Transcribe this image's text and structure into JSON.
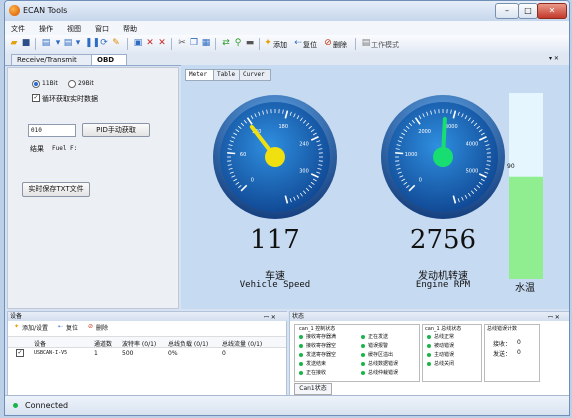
{
  "window": {
    "title": "ECAN Tools",
    "minimize": "–",
    "maximize": "□",
    "close": "✕"
  },
  "menu": [
    "文件",
    "操作",
    "视图",
    "窗口",
    "帮助"
  ],
  "toolbar": {
    "add_label": "添加",
    "reset_label": "复位",
    "delete_label": "删除",
    "workmode_label": "工作模式"
  },
  "tabs": {
    "receive_transmit": "Receive/Transmit",
    "obd": "OBD II",
    "pin": "▾ ✕"
  },
  "left": {
    "radio_11bit": "11Bit",
    "radio_29bit": "29Bit",
    "loop_checkbox": "循环获取实时数据",
    "pid_value": "010",
    "pid_button": "PID手动获取",
    "result_label": "结果",
    "result_value": "Fuel F:",
    "save_button": "实时保存TXT文件"
  },
  "right": {
    "inner_tabs": [
      "Meter",
      "Table",
      "Curver"
    ],
    "speed": {
      "value": "117",
      "label_cn": "车速",
      "label_en": "Vehicle Speed",
      "max": 360,
      "ticks": [
        "0",
        "60",
        "120",
        "180",
        "240",
        "300"
      ],
      "needle_color": "#f0e010"
    },
    "rpm": {
      "value": "2756",
      "label_cn": "发动机转速",
      "label_en": "Engine RPM",
      "max": 6000,
      "ticks": [
        "0",
        "1000",
        "2000",
        "3000",
        "4000",
        "5000"
      ],
      "needle_color": "#18dd70"
    },
    "temp": {
      "label_cn": "水温",
      "tick": "90",
      "fill_fraction": 0.55,
      "fill_color": "#90ee90"
    }
  },
  "device_panel": {
    "title": "设备",
    "pin": "ꟷ ✕",
    "toolbar": {
      "add": "添加/设置",
      "reset": "复位",
      "delete": "删除"
    },
    "columns": [
      "设备",
      "通道数",
      "波特率 (0/1)",
      "总线负载 (0/1)",
      "总线流量 (0/1)"
    ],
    "row": {
      "checked": "✓",
      "device": "USBCAN-I-V5",
      "channels": "1",
      "baud": "500",
      "load": "0%",
      "flow": "0"
    }
  },
  "status_panel": {
    "title": "状态",
    "pin": "ꟷ ✕",
    "ctrl_title": "can_1 控制状态",
    "ctrl_col1": [
      "接收寄存器满",
      "接收寄存器空",
      "发送寄存器空",
      "发送结束",
      "正在接收"
    ],
    "ctrl_col2": [
      "正在发送",
      "错误报警",
      "缓存区溢出",
      "总线数据错误",
      "总线仲裁错误"
    ],
    "bus_title": "can_1 总线状态",
    "bus_items": [
      "总线正常",
      "被动错误",
      "主动错误",
      "总线关闭"
    ],
    "err_title": "总线错误计数",
    "recv_label": "接收：",
    "recv_value": "0",
    "send_label": "发送：",
    "send_value": "0",
    "tab": "Can1状态"
  },
  "status": {
    "text": "Connected"
  }
}
